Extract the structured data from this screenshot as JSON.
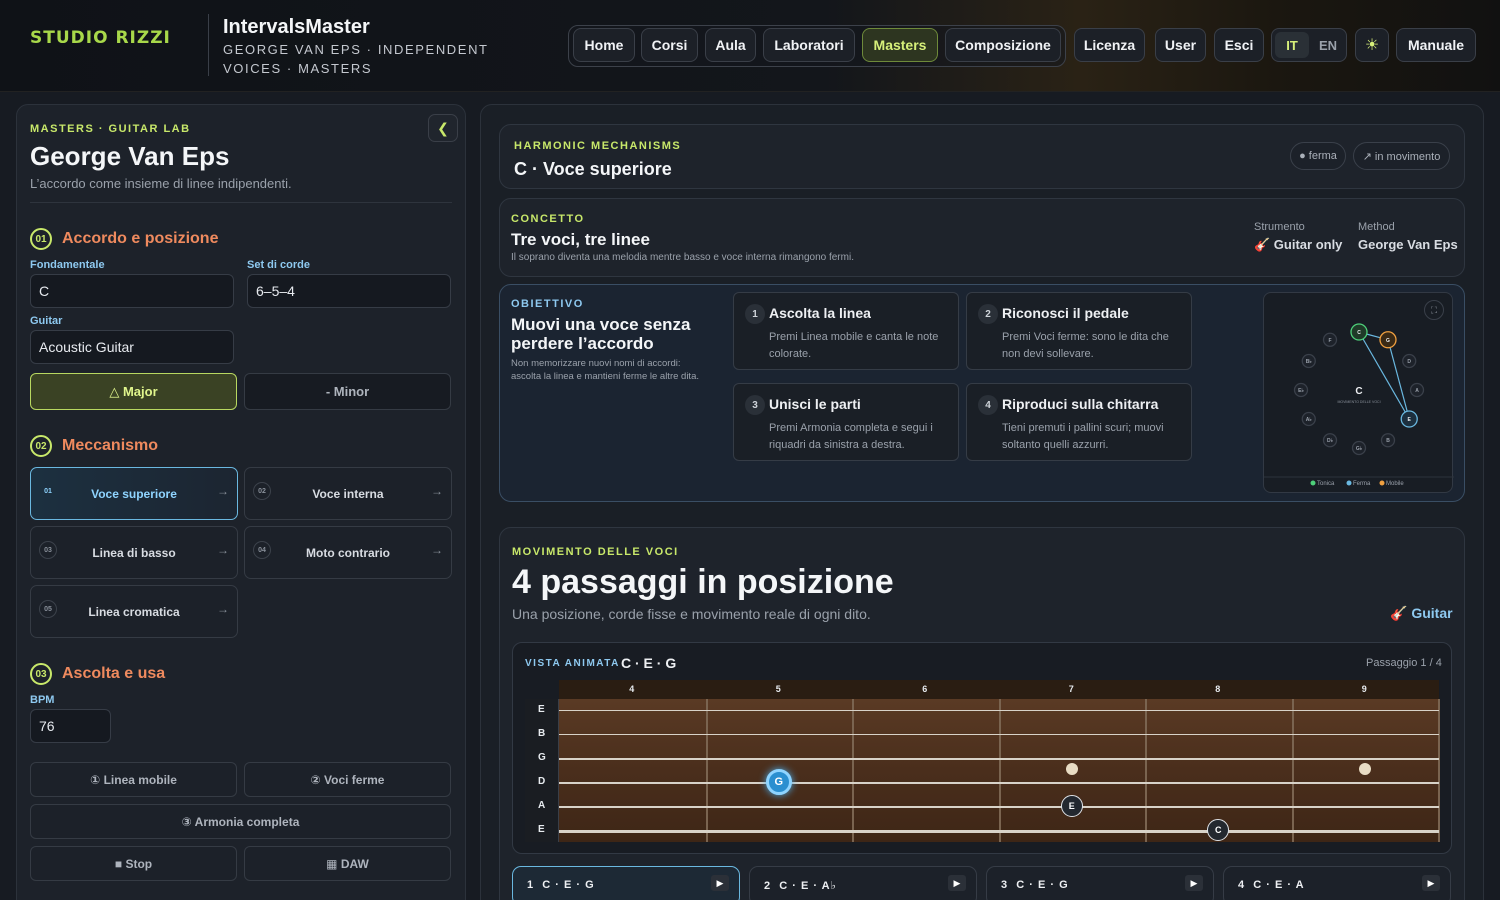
{
  "header": {
    "logo": "STUDIO RIZZI",
    "title": "IntervalsMaster",
    "subtitle": "GEORGE VAN EPS · INDEPENDENT VOICES · MASTERS",
    "nav": [
      "Home",
      "Corsi",
      "Aula",
      "Laboratori",
      "Masters",
      "Composizione"
    ],
    "active_nav": "Masters",
    "licenza": "Licenza",
    "user": "User",
    "esci": "Esci",
    "lang_it": "IT",
    "lang_en": "EN",
    "theme_icon": "sun-icon",
    "manuale": "Manuale"
  },
  "left": {
    "eyebrow": "MASTERS · GUITAR LAB",
    "collapse": "❮",
    "title": "George Van Eps",
    "subtitle": "L’accordo come insieme di linee indipendenti.",
    "sec1": {
      "num": "01",
      "title": "Accordo e posizione"
    },
    "fondamentale_label": "Fondamentale",
    "fondamentale": "C",
    "set_label": "Set di corde",
    "set": "6–5–4",
    "guitar_label": "Guitar",
    "guitar": "Acoustic Guitar",
    "major": "△ Major",
    "minor": "- Minor",
    "sec2": {
      "num": "02",
      "title": "Meccanismo"
    },
    "mechanisms": [
      {
        "n": "01",
        "label": "Voce superiore"
      },
      {
        "n": "02",
        "label": "Voce interna"
      },
      {
        "n": "03",
        "label": "Linea di basso"
      },
      {
        "n": "04",
        "label": "Moto contrario"
      },
      {
        "n": "05",
        "label": "Linea cromatica"
      }
    ],
    "sec3": {
      "num": "03",
      "title": "Ascolta e usa"
    },
    "bpm_label": "BPM",
    "bpm": "76",
    "btn_linea": "① Linea mobile",
    "btn_voci": "② Voci ferme",
    "btn_armonia": "③ Armonia completa",
    "btn_stop": "■ Stop",
    "btn_daw": "▦ DAW"
  },
  "top": {
    "eyebrow": "HARMONIC MECHANISMS",
    "title": "C · Voce superiore",
    "pill_ferma": "● ferma",
    "pill_mov": "↗ in movimento"
  },
  "concept": {
    "eyebrow": "CONCETTO",
    "title": "Tre voci, tre linee",
    "desc": "Il soprano diventa una melodia mentre basso e voce interna rimangono fermi.",
    "strumento_label": "Strumento",
    "strumento": "🎸 Guitar only",
    "method_label": "Method",
    "method": "George Van Eps"
  },
  "objective": {
    "eyebrow": "OBIETTIVO",
    "title": "Muovi una voce senza perdere l’accordo",
    "desc": "Non memorizzare nuovi nomi di accordi: ascolta la linea e mantieni ferme le altre dita.",
    "steps": [
      {
        "n": "1",
        "title": "Ascolta la linea",
        "desc": "Premi Linea mobile e canta le note colorate."
      },
      {
        "n": "2",
        "title": "Riconosci il pedale",
        "desc": "Premi Voci ferme: sono le dita che non devi sollevare."
      },
      {
        "n": "3",
        "title": "Unisci le parti",
        "desc": "Premi Armonia completa e segui i riquadri da sinistra a destra."
      },
      {
        "n": "4",
        "title": "Riproduci sulla chitarra",
        "desc": "Tieni premuti i pallini scuri; muovi soltanto quelli azzurri."
      }
    ],
    "wheel": {
      "center": "C",
      "caption": "MOVIMENTO DELLE VOCI",
      "notes": [
        "C",
        "G",
        "D",
        "A",
        "E",
        "B",
        "G♭",
        "D♭",
        "A♭",
        "E♭",
        "B♭",
        "F"
      ],
      "legend": [
        "Tonica",
        "Ferma",
        "Mobile"
      ],
      "colors": {
        "tonica": "#4ed07a",
        "ferma": "#6ab8e0",
        "mobile": "#f0a040"
      }
    }
  },
  "movement": {
    "eyebrow": "MOVIMENTO DELLE VOCI",
    "title": "4 passaggi in posizione",
    "subtitle": "Una posizione, corde fisse e movimento reale di ogni dito.",
    "guitar_link": "🎸 Guitar",
    "view_label": "VISTA ANIMATA",
    "chord": "C · E · G",
    "passaggio": "Passaggio 1 / 4",
    "frets": [
      "4",
      "5",
      "6",
      "7",
      "8",
      "9"
    ],
    "strings": [
      "E",
      "B",
      "G",
      "D",
      "A",
      "E"
    ],
    "notes": [
      {
        "label": "G",
        "string": 3,
        "fret": 5,
        "active": true
      },
      {
        "label": "E",
        "string": 4,
        "fret": 7
      },
      {
        "label": "C",
        "string": 5,
        "fret": 8
      }
    ],
    "tabs": [
      {
        "n": "1",
        "label": "C · E · G"
      },
      {
        "n": "2",
        "label": "C · E · A♭"
      },
      {
        "n": "3",
        "label": "C · E · G"
      },
      {
        "n": "4",
        "label": "C · E · A"
      }
    ]
  }
}
